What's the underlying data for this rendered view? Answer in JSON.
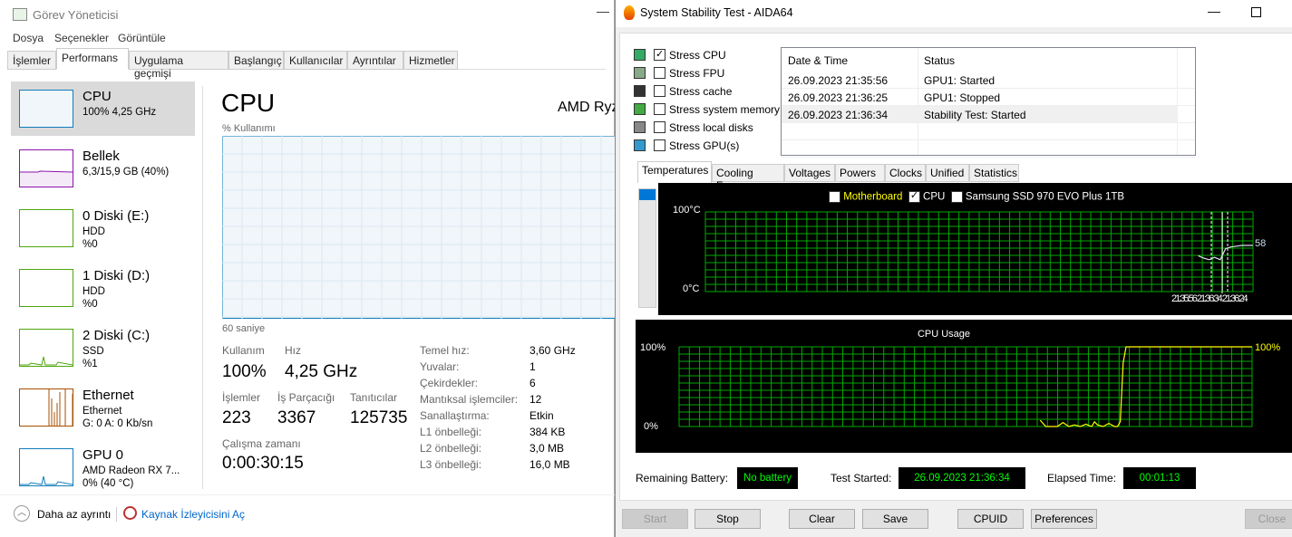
{
  "task_manager": {
    "title": "Görev Yöneticisi",
    "menu": [
      "Dosya",
      "Seçenekler",
      "Görüntüle"
    ],
    "tabs": [
      "İşlemler",
      "Performans",
      "Uygulama geçmişi",
      "Başlangıç",
      "Kullanıcılar",
      "Ayrıntılar",
      "Hizmetler"
    ],
    "active_tab": "Performans",
    "sidebar": [
      {
        "name": "CPU",
        "line1": "100% 4,25 GHz",
        "line2": "",
        "color": "#117dbb"
      },
      {
        "name": "Bellek",
        "line1": "6,3/15,9 GB (40%)",
        "line2": "",
        "color": "#8b12ae"
      },
      {
        "name": "0 Diski (E:)",
        "line1": "HDD",
        "line2": "%0",
        "color": "#4da60c"
      },
      {
        "name": "1 Diski (D:)",
        "line1": "HDD",
        "line2": "%0",
        "color": "#4da60c"
      },
      {
        "name": "2 Diski (C:)",
        "line1": "SSD",
        "line2": "%1",
        "color": "#4da60c"
      },
      {
        "name": "Ethernet",
        "line1": "Ethernet",
        "line2": "G: 0 A: 0 Kb/sn",
        "color": "#a74f01"
      },
      {
        "name": "GPU 0",
        "line1": "AMD Radeon RX 7...",
        "line2": "0% (40 °C)",
        "color": "#117dbb"
      }
    ],
    "main": {
      "title": "CPU",
      "cpu_name": "AMD Ryz",
      "usage_label": "% Kullanımı",
      "time_label": "60 saniye",
      "stats": {
        "usage_label": "Kullanım",
        "usage": "100%",
        "speed_label": "Hız",
        "speed": "4,25 GHz",
        "processes_label": "İşlemler",
        "processes": "223",
        "threads_label": "İş Parçacığı",
        "threads": "3367",
        "handles_label": "Tanıtıcılar",
        "handles": "125735",
        "uptime_label": "Çalışma zamanı",
        "uptime": "0:00:30:15"
      },
      "specs": [
        {
          "k": "Temel hız:",
          "v": "3,60 GHz"
        },
        {
          "k": "Yuvalar:",
          "v": "1"
        },
        {
          "k": "Çekirdekler:",
          "v": "6"
        },
        {
          "k": "Mantıksal işlemciler:",
          "v": "12"
        },
        {
          "k": "Sanallaştırma:",
          "v": "Etkin"
        },
        {
          "k": "L1 önbelleği:",
          "v": "384 KB"
        },
        {
          "k": "L2 önbelleği:",
          "v": "3,0 MB"
        },
        {
          "k": "L3 önbelleği:",
          "v": "16,0 MB"
        }
      ]
    },
    "footer": {
      "less_details": "Daha az ayrıntı",
      "resource_monitor": "Kaynak İzleyicisini Aç"
    }
  },
  "aida": {
    "title": "System Stability Test - AIDA64",
    "stress": [
      {
        "label": "Stress CPU",
        "checked": true
      },
      {
        "label": "Stress FPU",
        "checked": false
      },
      {
        "label": "Stress cache",
        "checked": false
      },
      {
        "label": "Stress system memory",
        "checked": false
      },
      {
        "label": "Stress local disks",
        "checked": false
      },
      {
        "label": "Stress GPU(s)",
        "checked": false
      }
    ],
    "log": {
      "headers": [
        "Date & Time",
        "Status"
      ],
      "rows": [
        [
          "26.09.2023 21:35:56",
          "GPU1: Started"
        ],
        [
          "26.09.2023 21:36:25",
          "GPU1: Stopped"
        ],
        [
          "26.09.2023 21:36:34",
          "Stability Test: Started"
        ]
      ]
    },
    "tabs": [
      "Temperatures",
      "Cooling Fans",
      "Voltages",
      "Powers",
      "Clocks",
      "Unified",
      "Statistics"
    ],
    "temp_chart": {
      "legend": [
        {
          "label": "Motherboard",
          "checked": false,
          "color": "#ffff00"
        },
        {
          "label": "CPU",
          "checked": true,
          "color": "#ffffff"
        },
        {
          "label": "Samsung SSD 970 EVO Plus 1TB",
          "checked": false,
          "color": "#ffffff"
        }
      ],
      "ymax_label": "100°C",
      "ymin_label": "0°C",
      "time_labels": "21:35:56 21:36:34 21:36:24",
      "last_value": "58",
      "series": [
        [
          90,
          45
        ],
        [
          91,
          42
        ],
        [
          92,
          40
        ],
        [
          93,
          43
        ],
        [
          94,
          40
        ],
        [
          95,
          54
        ],
        [
          96,
          56
        ],
        [
          97,
          57
        ],
        [
          98,
          58
        ],
        [
          99,
          58
        ],
        [
          100,
          58
        ]
      ]
    },
    "usage_chart": {
      "title": "CPU Usage",
      "ymax_label": "100%",
      "ymin_label": "0%",
      "last_value": "100%",
      "series": [
        [
          63,
          8
        ],
        [
          64,
          0
        ],
        [
          65,
          0
        ],
        [
          66,
          0
        ],
        [
          67,
          5
        ],
        [
          68,
          0
        ],
        [
          69,
          2
        ],
        [
          70,
          0
        ],
        [
          71,
          3
        ],
        [
          72,
          0
        ],
        [
          72.5,
          6
        ],
        [
          73,
          2
        ],
        [
          74,
          0
        ],
        [
          75,
          4
        ],
        [
          76,
          0
        ],
        [
          76.5,
          0
        ],
        [
          77,
          6
        ],
        [
          77.5,
          80
        ],
        [
          78,
          100
        ],
        [
          100,
          100
        ]
      ]
    },
    "status": {
      "battery_label": "Remaining Battery:",
      "battery": "No battery",
      "started_label": "Test Started:",
      "started": "26.09.2023 21:36:34",
      "elapsed_label": "Elapsed Time:",
      "elapsed": "00:01:13"
    },
    "buttons": [
      "Start",
      "Stop",
      "Clear",
      "Save",
      "CPUID",
      "Preferences",
      "Close"
    ]
  }
}
